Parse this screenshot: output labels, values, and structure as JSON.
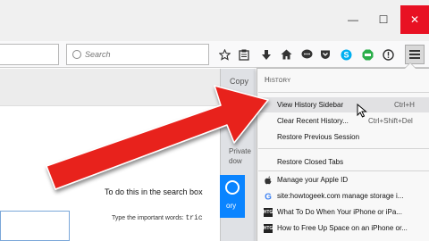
{
  "window": {
    "minimize_glyph": "—",
    "maximize_glyph": "☐",
    "close_glyph": "✕"
  },
  "toolbar": {
    "search_placeholder": "Search",
    "icons": [
      "star-icon",
      "reader-list-icon",
      "download-icon",
      "home-icon",
      "chat-icon",
      "pocket-icon",
      "skype-icon",
      "adblock-icon",
      "info-icon",
      "hamburger-menu-icon"
    ]
  },
  "page": {
    "heading": "To do this in the search box",
    "subtext_prefix": "Type the important words:",
    "subtext_code": "tric"
  },
  "strip": {
    "copy_label": "Copy",
    "private_line1": "Private",
    "private_line2": "dow",
    "blue_label": "ory"
  },
  "history_panel": {
    "title": "History",
    "menu_items": [
      {
        "label": "View History Sidebar",
        "shortcut": "Ctrl+H",
        "highlighted": true
      },
      {
        "label": "Clear Recent History...",
        "shortcut": "Ctrl+Shift+Del",
        "highlighted": false
      },
      {
        "label": "Restore Previous Session",
        "shortcut": "",
        "highlighted": false
      }
    ],
    "closed_tabs_label": "Restore Closed Tabs",
    "history_items": [
      {
        "favicon": "apple-icon",
        "label": "Manage your Apple ID"
      },
      {
        "favicon": "google-icon",
        "label": "site:howtogeek.com manage storage i..."
      },
      {
        "favicon": "htg-icon",
        "label": "What To Do When Your iPhone or iPa..."
      },
      {
        "favicon": "htg-icon",
        "label": "How to Free Up Space on an iPhone or..."
      }
    ]
  },
  "colors": {
    "highlight_arrow": "#e8221c",
    "close_button": "#e81123",
    "accent_blue": "#0a84ff"
  }
}
